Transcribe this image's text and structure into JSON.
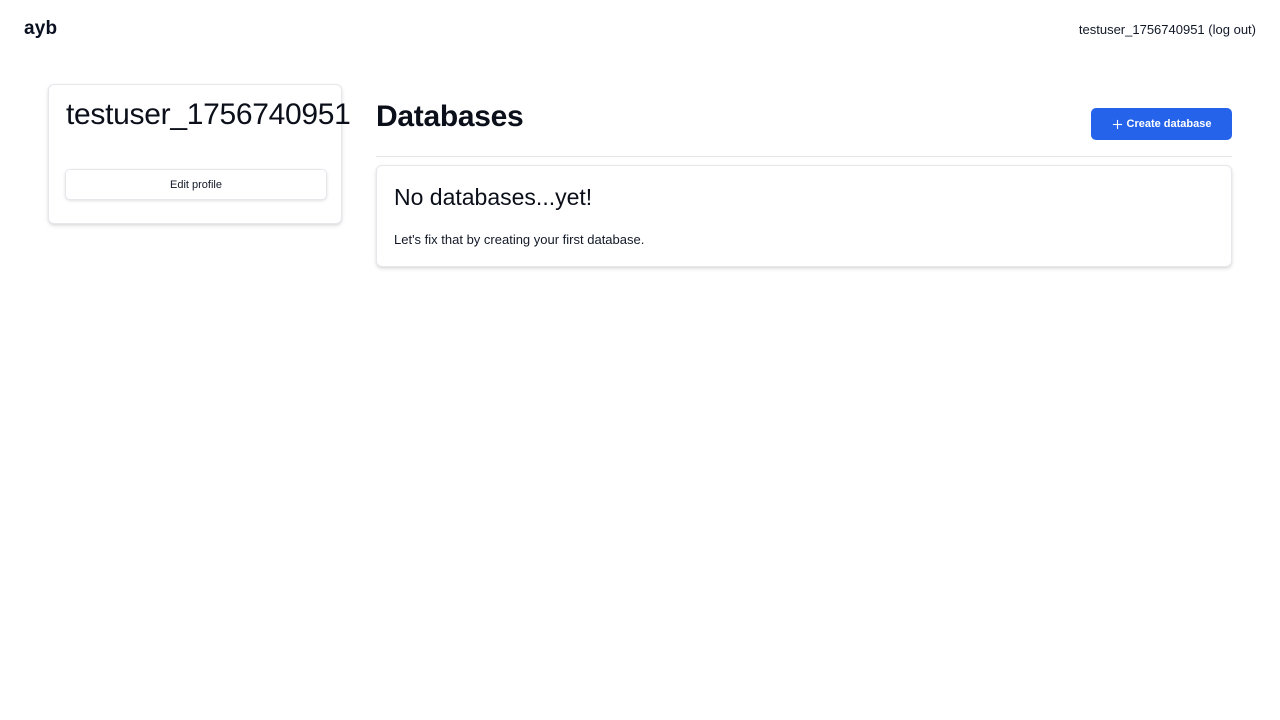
{
  "header": {
    "logo": "ayb",
    "username": "testuser_1756740951",
    "logout_label": "(log out)"
  },
  "profile": {
    "name": "testuser_1756740951",
    "edit_label": "Edit profile"
  },
  "databases": {
    "title": "Databases",
    "create_label": "Create database",
    "create_icon": "plus-icon",
    "empty_title": "No databases...yet!",
    "empty_text": "Let's fix that by creating your first database."
  },
  "colors": {
    "accent": "#2563eb",
    "border": "#e5e7eb",
    "text": "#0b0f19"
  }
}
